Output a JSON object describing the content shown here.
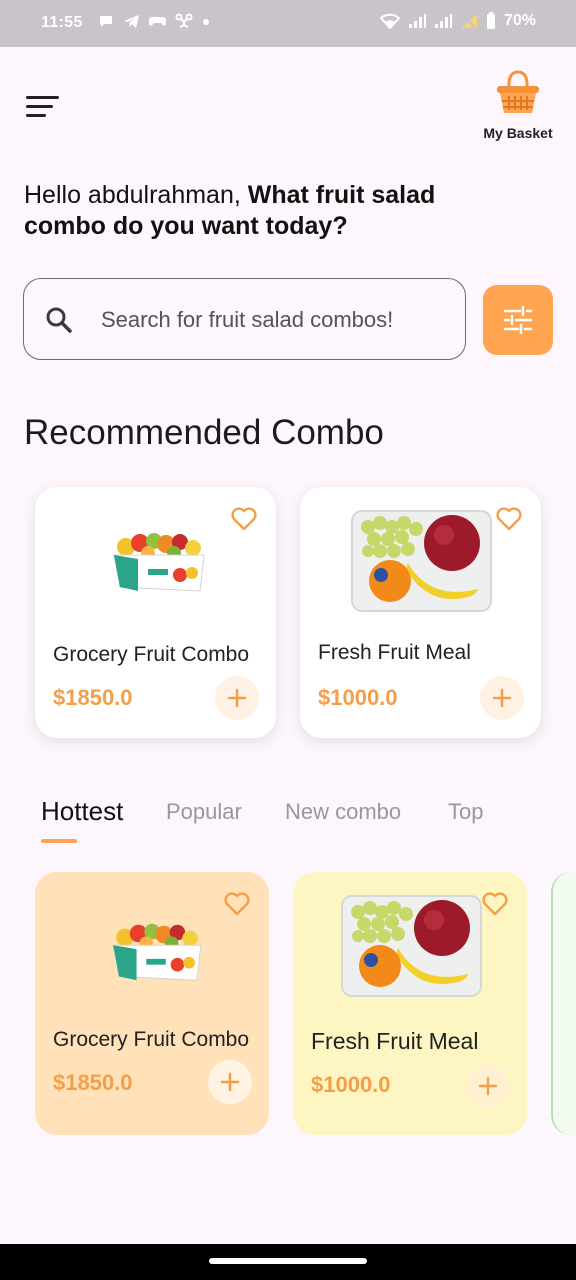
{
  "status_bar": {
    "time": "11:55",
    "battery": "70%",
    "icons": [
      "message-icon",
      "telegram-icon",
      "game-icon",
      "drone-icon",
      "dot-icon",
      "wifi-icon",
      "signal-icon",
      "signal-icon",
      "no-signal-icon",
      "battery-icon"
    ]
  },
  "header": {
    "menu_icon": "menu-icon",
    "basket_icon": "basket-icon",
    "basket_label": "My Basket"
  },
  "greeting": {
    "prefix": "Hello abdulrahman,",
    "question": "What fruit salad combo do you want today?"
  },
  "search": {
    "placeholder": "Search for fruit salad combos!",
    "icon": "search-icon",
    "filter_icon": "filter-icon"
  },
  "recommended": {
    "title": "Recommended Combo",
    "items": [
      {
        "name": "Grocery Fruit Combo",
        "price": "$1850.0"
      },
      {
        "name": "Fresh Fruit Meal",
        "price": "$1000.0"
      }
    ]
  },
  "tabs": {
    "items": [
      "Hottest",
      "Popular",
      "New combo",
      "Top"
    ],
    "active": "Hottest"
  },
  "hottest": {
    "items": [
      {
        "name": "Grocery Fruit Combo",
        "price": "$1850.0"
      },
      {
        "name": "Fresh Fruit Meal",
        "price": "$1000.0"
      }
    ]
  },
  "colors": {
    "accent": "#FFA451",
    "price": "#F39F4A",
    "card_orange": "#FFE2BA",
    "card_yellow": "#FEF6C2",
    "background": "#FDF6FC"
  }
}
